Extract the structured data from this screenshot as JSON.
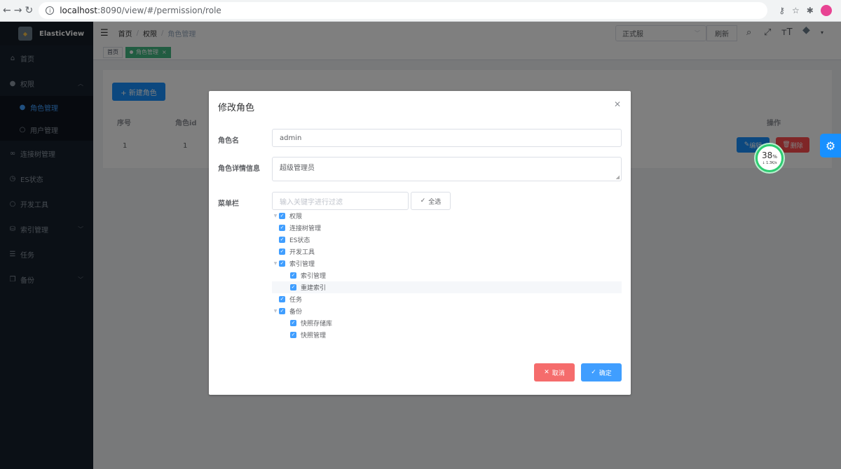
{
  "browser": {
    "url_host": "localhost",
    "url_path": ":8090/view/#/permission/role"
  },
  "sidebar": {
    "app_name": "ElasticView",
    "items": [
      {
        "label": "首页",
        "icon": "home-icon"
      },
      {
        "label": "权限",
        "icon": "user-icon"
      },
      {
        "label": "角色管理",
        "icon": "user-icon"
      },
      {
        "label": "用户管理",
        "icon": "user-icon"
      },
      {
        "label": "连接树管理",
        "icon": "link-icon"
      },
      {
        "label": "ES状态",
        "icon": "clock-icon"
      },
      {
        "label": "开发工具",
        "icon": "circle-icon"
      },
      {
        "label": "索引管理",
        "icon": "database-icon"
      },
      {
        "label": "任务",
        "icon": "list-icon"
      },
      {
        "label": "备份",
        "icon": "copy-icon"
      }
    ]
  },
  "topbar": {
    "breadcrumb": [
      "首页",
      "权限",
      "角色管理"
    ],
    "env_value": "正式服",
    "refresh_label": "刷新"
  },
  "tags": {
    "home": "首页",
    "active": "角色管理"
  },
  "page": {
    "new_role_label": "+ 新建角色",
    "columns": {
      "seq": "序号",
      "role_id": "角色id",
      "ops": "操作"
    },
    "row": {
      "seq": "1",
      "role_id": "1"
    },
    "edit_label": "编辑",
    "delete_label": "删除"
  },
  "speed": {
    "percent": "38",
    "percent_unit": "%",
    "rate": "↓ 1.3K/s"
  },
  "dialog": {
    "title": "修改角色",
    "role_name_label": "角色名",
    "role_name_value": "admin",
    "detail_label": "角色详情信息",
    "detail_value": "超级管理员",
    "menu_label": "菜单栏",
    "filter_placeholder": "输入关键字进行过滤",
    "select_all_label": "全选",
    "tree": [
      {
        "label": "权限",
        "level": 0,
        "expandable": true,
        "checked": true
      },
      {
        "label": "连接树管理",
        "level": 0,
        "expandable": false,
        "checked": true
      },
      {
        "label": "ES状态",
        "level": 0,
        "expandable": false,
        "checked": true
      },
      {
        "label": "开发工具",
        "level": 0,
        "expandable": false,
        "checked": true
      },
      {
        "label": "索引管理",
        "level": 0,
        "expandable": true,
        "checked": true
      },
      {
        "label": "索引管理",
        "level": 1,
        "expandable": false,
        "checked": true
      },
      {
        "label": "重建索引",
        "level": 1,
        "expandable": false,
        "checked": true
      },
      {
        "label": "任务",
        "level": 0,
        "expandable": false,
        "checked": true
      },
      {
        "label": "备份",
        "level": 0,
        "expandable": true,
        "checked": true
      },
      {
        "label": "快照存储库",
        "level": 1,
        "expandable": false,
        "checked": true
      },
      {
        "label": "快照管理",
        "level": 1,
        "expandable": false,
        "checked": true
      }
    ],
    "cancel_label": "取消",
    "confirm_label": "确定"
  }
}
